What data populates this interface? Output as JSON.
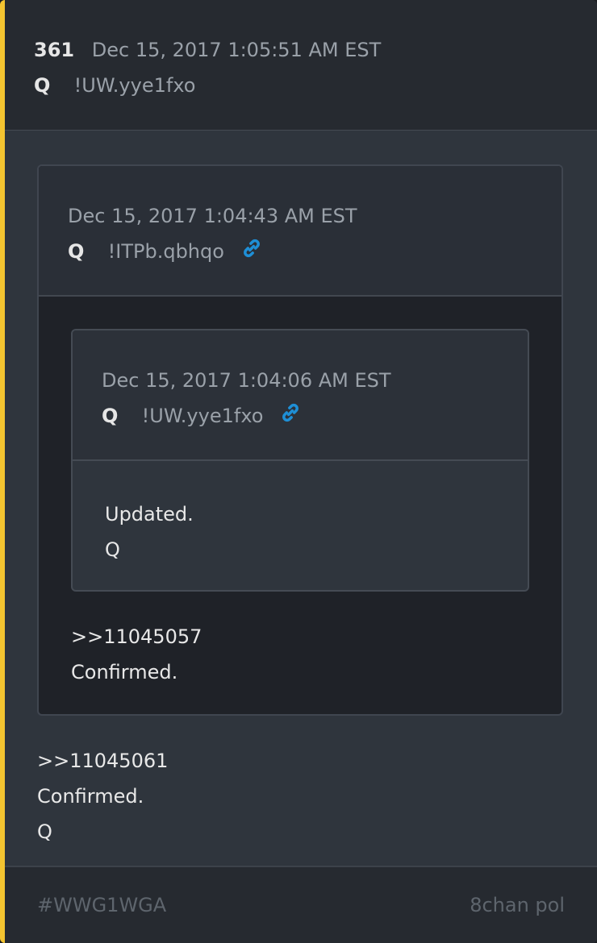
{
  "post": {
    "number": "361",
    "date": "Dec 15, 2017 1:05:51 AM EST",
    "author": "Q",
    "tripcode": "!UW.yye1fxo",
    "body_lines": [
      ">>11045061",
      "Confirmed.",
      "Q"
    ]
  },
  "quote": {
    "date": "Dec 15, 2017 1:04:43 AM EST",
    "author": "Q",
    "tripcode": "!ITPb.qbhqo",
    "link_icon": "link-icon",
    "body_lines": [
      ">>11045057",
      "Confirmed."
    ]
  },
  "nested_quote": {
    "date": "Dec 15, 2017 1:04:06 AM EST",
    "author": "Q",
    "tripcode": "!UW.yye1fxo",
    "link_icon": "link-icon",
    "body_lines": [
      "Updated.",
      "Q"
    ]
  },
  "footer": {
    "hashtag": "#WWG1WGA",
    "source": "8chan pol"
  },
  "colors": {
    "accent_bar": "#f4c430",
    "link_icon": "#1e8fd6"
  }
}
